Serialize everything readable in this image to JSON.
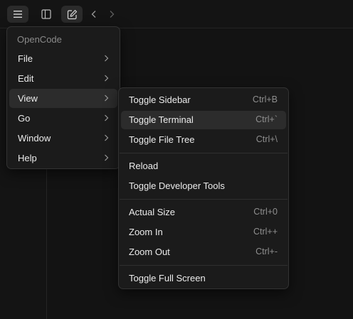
{
  "toolbar": {
    "icons": [
      "menu-icon",
      "sidebar-toggle-icon",
      "new-session-icon",
      "back-icon",
      "forward-icon"
    ]
  },
  "menu": {
    "header": "OpenCode",
    "items": [
      {
        "label": "File"
      },
      {
        "label": "Edit"
      },
      {
        "label": "View"
      },
      {
        "label": "Go"
      },
      {
        "label": "Window"
      },
      {
        "label": "Help"
      }
    ]
  },
  "view_submenu": {
    "items": [
      {
        "label": "Toggle Sidebar",
        "shortcut": "Ctrl+B"
      },
      {
        "label": "Toggle Terminal",
        "shortcut": "Ctrl+`"
      },
      {
        "label": "Toggle File Tree",
        "shortcut": "Ctrl+\\"
      },
      {
        "label": "Reload",
        "shortcut": ""
      },
      {
        "label": "Toggle Developer Tools",
        "shortcut": ""
      },
      {
        "label": "Actual Size",
        "shortcut": "Ctrl+0"
      },
      {
        "label": "Zoom In",
        "shortcut": "Ctrl++"
      },
      {
        "label": "Zoom Out",
        "shortcut": "Ctrl+-"
      },
      {
        "label": "Toggle Full Screen",
        "shortcut": ""
      }
    ]
  },
  "colors": {
    "background": "#131313",
    "menu_bg": "#1b1b1b",
    "hover_bg": "#2c2c2c",
    "shortcut_text": "#8f8f8f"
  }
}
